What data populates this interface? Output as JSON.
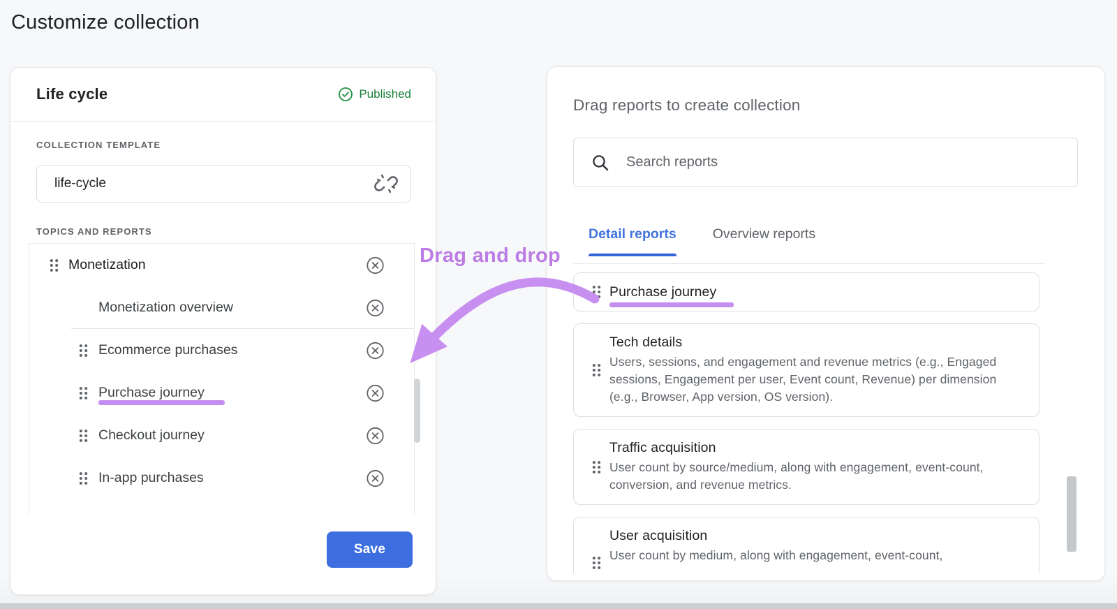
{
  "page": {
    "title": "Customize collection"
  },
  "left_panel": {
    "title": "Life cycle",
    "status_label": "Published",
    "template_label": "COLLECTION TEMPLATE",
    "template_value": "life-cycle",
    "topics_label": "TOPICS AND REPORTS",
    "items": [
      {
        "label": "Monetization",
        "kind": "topic",
        "drag": true,
        "removable": true
      },
      {
        "label": "Monetization overview",
        "kind": "overview",
        "drag": false,
        "removable": true,
        "divider_below": true
      },
      {
        "label": "Ecommerce purchases",
        "kind": "report",
        "drag": true,
        "removable": true
      },
      {
        "label": "Purchase journey",
        "kind": "report",
        "drag": true,
        "removable": true,
        "highlighted": true
      },
      {
        "label": "Checkout journey",
        "kind": "report",
        "drag": true,
        "removable": true
      },
      {
        "label": "In-app purchases",
        "kind": "report",
        "drag": true,
        "removable": true
      }
    ],
    "save_label": "Save"
  },
  "right_panel": {
    "title": "Drag reports to create collection",
    "search_placeholder": "Search reports",
    "tabs": [
      {
        "label": "Detail reports",
        "active": true
      },
      {
        "label": "Overview reports",
        "active": false
      }
    ],
    "reports": [
      {
        "title": "Purchase journey",
        "description": "",
        "highlighted": true
      },
      {
        "title": "Tech details",
        "description": "Users, sessions, and engagement and revenue metrics (e.g., Engaged sessions, Engagement per user, Event count, Revenue) per dimension (e.g., Browser, App version, OS version)."
      },
      {
        "title": "Traffic acquisition",
        "description": "User count by source/medium, along with engagement, event-count, conversion, and revenue metrics."
      },
      {
        "title": "User acquisition",
        "description": "User count by medium, along with engagement, event-count,",
        "clipped": true
      }
    ]
  },
  "annotation": {
    "label": "Drag and drop"
  },
  "colors": {
    "accent_blue": "#3d6ee0",
    "tab_blue": "#4273dc",
    "published_green": "#188038",
    "highlight_purple": "#c58ff0",
    "annotation_purple": "#bb7ce4"
  }
}
